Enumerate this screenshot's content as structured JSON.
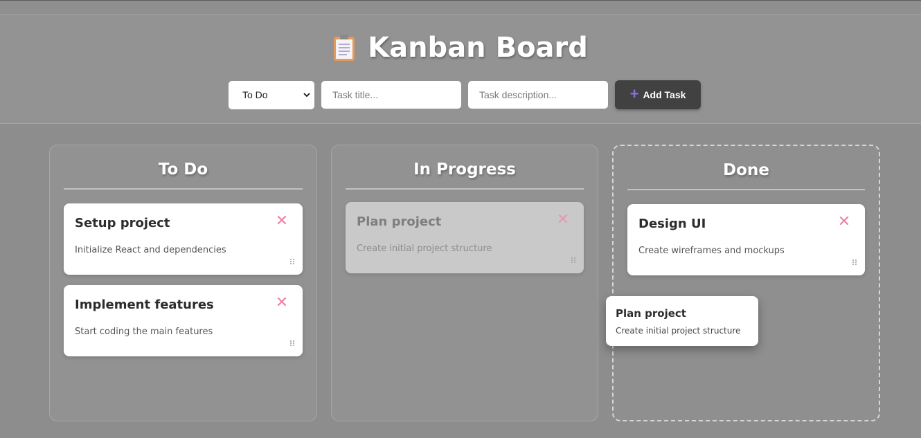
{
  "header": {
    "title": "Kanban Board",
    "icon": "clipboard-icon"
  },
  "form": {
    "status_select": {
      "selected": "To Do"
    },
    "title_input": {
      "placeholder": "Task title..."
    },
    "desc_input": {
      "placeholder": "Task description..."
    },
    "add_button": {
      "label": "Add Task"
    }
  },
  "columns": [
    {
      "title": "To Do",
      "cards": [
        {
          "title": "Setup project",
          "description": "Initialize React and dependencies"
        },
        {
          "title": "Implement features",
          "description": "Start coding the main features"
        }
      ]
    },
    {
      "title": "In Progress",
      "cards": [
        {
          "title": "Plan project",
          "description": "Create initial project structure"
        }
      ]
    },
    {
      "title": "Done",
      "cards": [
        {
          "title": "Design UI",
          "description": "Create wireframes and mockups"
        }
      ]
    }
  ],
  "dragging_card": {
    "title": "Plan project",
    "description": "Create initial project structure"
  },
  "colors": {
    "accent": "#8c6ee0",
    "delete": "#f0809f",
    "button": "#414141"
  }
}
